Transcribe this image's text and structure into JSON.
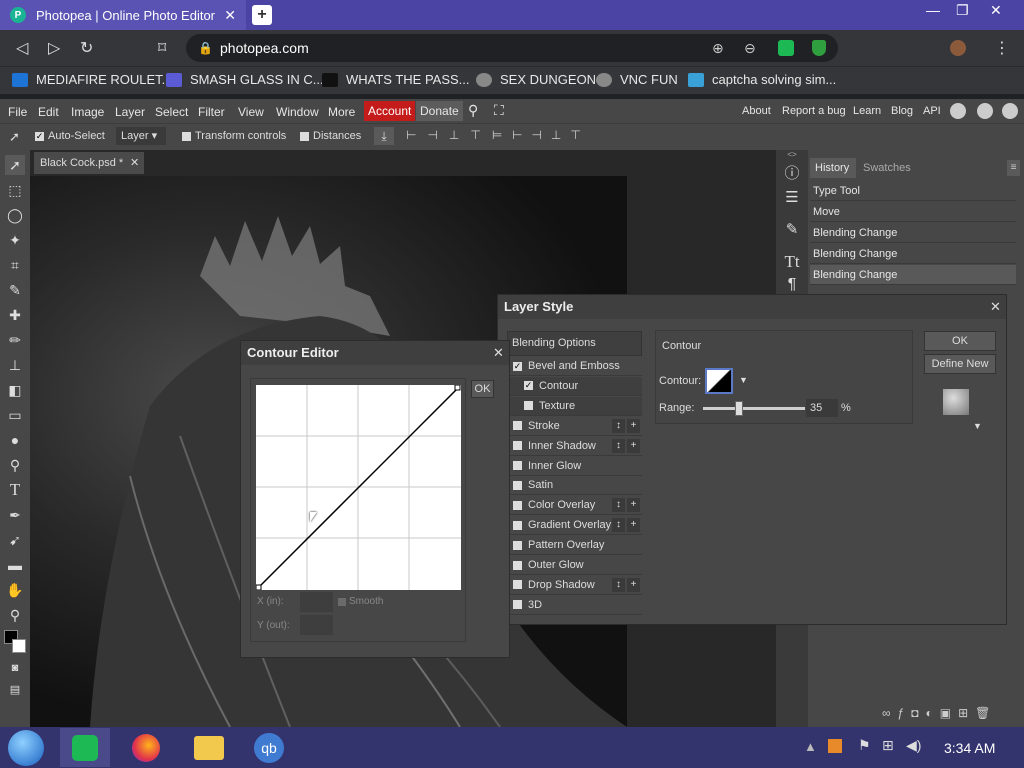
{
  "browser": {
    "tab_title": "Photopea | Online Photo Editor",
    "url": "photopea.com",
    "bookmarks": [
      {
        "label": "MEDIAFIRE ROULET...",
        "icon": "mediafire-icon",
        "color": "#1e73d6"
      },
      {
        "label": "SMASH GLASS IN C...",
        "icon": "glass-icon",
        "color": "#5b5bd6"
      },
      {
        "label": "WHATS THE PASS...",
        "icon": "hat-icon",
        "color": "#222"
      },
      {
        "label": "SEX DUNGEON",
        "icon": "gear-icon",
        "color": "#888"
      },
      {
        "label": "VNC FUN",
        "icon": "gear-icon",
        "color": "#888"
      },
      {
        "label": "captcha solving sim...",
        "icon": "triangle-icon",
        "color": "#3aa0d8"
      }
    ]
  },
  "menu": {
    "items": [
      "File",
      "Edit",
      "Image",
      "Layer",
      "Select",
      "Filter",
      "View",
      "Window",
      "More"
    ],
    "account": "Account",
    "donate": "Donate",
    "right": [
      "About",
      "Report a bug",
      "Learn",
      "Blog",
      "API"
    ]
  },
  "options": {
    "auto_select": "Auto-Select",
    "layer": "Layer",
    "transform": "Transform controls",
    "distances": "Distances"
  },
  "document": {
    "tab": "Black Cock.psd *"
  },
  "panel": {
    "tabs": [
      "History",
      "Swatches"
    ],
    "history": [
      "Type Tool",
      "Move",
      "Blending Change",
      "Blending Change",
      "Blending Change"
    ]
  },
  "contour_editor": {
    "title": "Contour Editor",
    "ok": "OK",
    "x_label": "X (in):",
    "y_label": "Y (out):",
    "smooth": "Smooth"
  },
  "layer_style": {
    "title": "Layer Style",
    "blending_options": "Blending Options",
    "items": [
      {
        "label": "Bevel and Emboss",
        "checked": true,
        "indent": false,
        "extra": false
      },
      {
        "label": "Contour",
        "checked": true,
        "indent": true,
        "extra": false
      },
      {
        "label": "Texture",
        "checked": false,
        "indent": true,
        "extra": false
      },
      {
        "label": "Stroke",
        "checked": false,
        "indent": false,
        "extra": true
      },
      {
        "label": "Inner Shadow",
        "checked": false,
        "indent": false,
        "extra": true
      },
      {
        "label": "Inner Glow",
        "checked": false,
        "indent": false,
        "extra": false
      },
      {
        "label": "Satin",
        "checked": false,
        "indent": false,
        "extra": false
      },
      {
        "label": "Color Overlay",
        "checked": false,
        "indent": false,
        "extra": true
      },
      {
        "label": "Gradient Overlay",
        "checked": false,
        "indent": false,
        "extra": true
      },
      {
        "label": "Pattern Overlay",
        "checked": false,
        "indent": false,
        "extra": false
      },
      {
        "label": "Outer Glow",
        "checked": false,
        "indent": false,
        "extra": false
      },
      {
        "label": "Drop Shadow",
        "checked": false,
        "indent": false,
        "extra": true
      },
      {
        "label": "3D",
        "checked": false,
        "indent": false,
        "extra": false
      }
    ],
    "section": "Contour",
    "contour_label": "Contour:",
    "range_label": "Range:",
    "range_value": "35",
    "range_unit": "%",
    "ok": "OK",
    "define_new": "Define New"
  },
  "taskbar": {
    "time": "3:34 AM"
  }
}
